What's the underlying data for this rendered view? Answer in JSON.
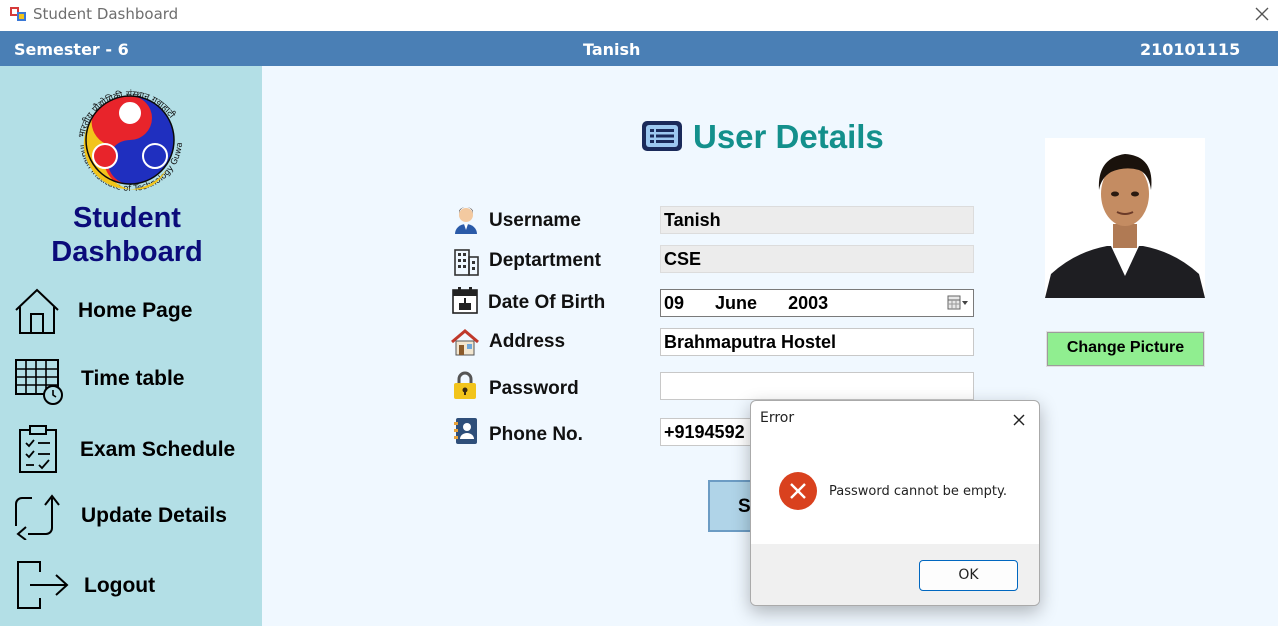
{
  "window": {
    "title": "Student Dashboard"
  },
  "infobar": {
    "semester": "Semester - 6",
    "name": "Tanish",
    "roll_no": "210101115"
  },
  "sidebar": {
    "logo_text_top": "भारतीय प्रौद्योगिकी संस्थान गुवाहाटी",
    "logo_text_bottom": "Indian Institute of Technology Guwahati",
    "title_line1": "Student",
    "title_line2": "Dashboard",
    "items": [
      {
        "label": "Home Page",
        "icon": "home-icon"
      },
      {
        "label": "Time table",
        "icon": "timetable-icon"
      },
      {
        "label": "Exam Schedule",
        "icon": "clipboard-check-icon"
      },
      {
        "label": "Update Details",
        "icon": "swap-arrows-icon"
      },
      {
        "label": "Logout",
        "icon": "logout-icon"
      }
    ]
  },
  "main": {
    "heading": "User Details",
    "fields": {
      "username": {
        "label": "Username",
        "value": "Tanish"
      },
      "department": {
        "label": "Deptartment",
        "value": "CSE"
      },
      "dob": {
        "label": "Date Of Birth",
        "day": "09",
        "month": "June",
        "year": "2003"
      },
      "address": {
        "label": "Address",
        "value": "Brahmaputra Hostel"
      },
      "password": {
        "label": "Password",
        "value": ""
      },
      "phone": {
        "label": "Phone No.",
        "value": "+9194592"
      }
    },
    "change_picture_label": "Change Picture",
    "save_label": "Sa"
  },
  "dialog": {
    "title": "Error",
    "message": "Password cannot be empty.",
    "ok_label": "OK"
  },
  "colors": {
    "infobar": "#4a7fb5",
    "sidebar": "#b3dfe6",
    "main_bg": "#f0f8ff",
    "heading": "#13908c",
    "sidebar_title": "#0b0b7a",
    "change_picture": "#90ee90",
    "error": "#d9411e"
  }
}
